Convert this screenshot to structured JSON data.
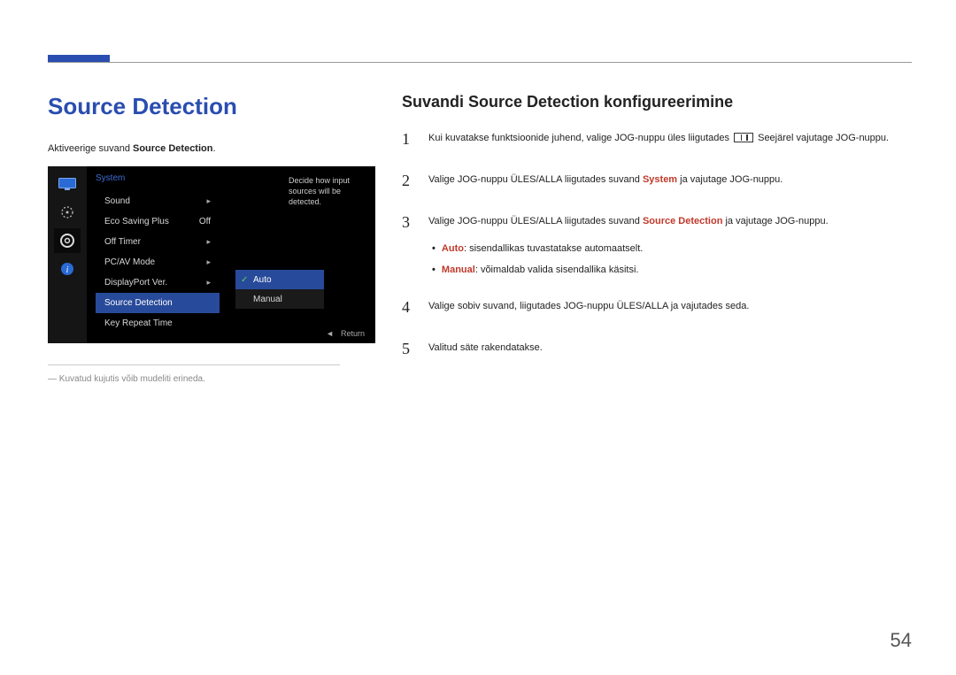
{
  "page": {
    "number": "54"
  },
  "left": {
    "title": "Source Detection",
    "intro_pre": "Aktiveerige suvand ",
    "intro_bold": "Source Detection",
    "intro_post": ".",
    "disclaimer": "Kuvatud kujutis võib mudeliti erineda."
  },
  "osd": {
    "header": "System",
    "desc": "Decide how input sources will be detected.",
    "items": [
      {
        "label": "Sound",
        "value": "",
        "arrow": true
      },
      {
        "label": "Eco Saving Plus",
        "value": "Off",
        "arrow": false
      },
      {
        "label": "Off Timer",
        "value": "",
        "arrow": true
      },
      {
        "label": "PC/AV Mode",
        "value": "",
        "arrow": true
      },
      {
        "label": "DisplayPort Ver.",
        "value": "",
        "arrow": true
      },
      {
        "label": "Source Detection",
        "value": "",
        "arrow": false,
        "selected": true
      },
      {
        "label": "Key Repeat Time",
        "value": "",
        "arrow": false
      }
    ],
    "popup": [
      {
        "label": "Auto",
        "selected": true
      },
      {
        "label": "Manual",
        "selected": false
      }
    ],
    "footer_nav": "◄",
    "footer_label": "Return"
  },
  "right": {
    "title": "Suvandi Source Detection konfigureerimine",
    "steps": {
      "s1": {
        "num": "1",
        "pre": "Kui kuvatakse funktsioonide juhend, valige JOG-nuppu üles liigutades ",
        "post": " Seejärel vajutage JOG-nuppu."
      },
      "s2": {
        "num": "2",
        "pre": "Valige JOG-nuppu ÜLES/ALLA liigutades suvand ",
        "hl": "System",
        "post": " ja vajutage JOG-nuppu."
      },
      "s3": {
        "num": "3",
        "pre": "Valige JOG-nuppu ÜLES/ALLA liigutades suvand ",
        "hl": "Source Detection",
        "post": " ja vajutage JOG-nuppu."
      },
      "sub1": {
        "hl": "Auto",
        "rest": ": sisendallikas tuvastatakse automaatselt."
      },
      "sub2": {
        "hl": "Manual",
        "rest": ": võimaldab valida sisendallika käsitsi."
      },
      "s4": {
        "num": "4",
        "text": "Valige sobiv suvand, liigutades JOG-nuppu ÜLES/ALLA ja vajutades seda."
      },
      "s5": {
        "num": "5",
        "text": "Valitud säte rakendatakse."
      }
    }
  }
}
